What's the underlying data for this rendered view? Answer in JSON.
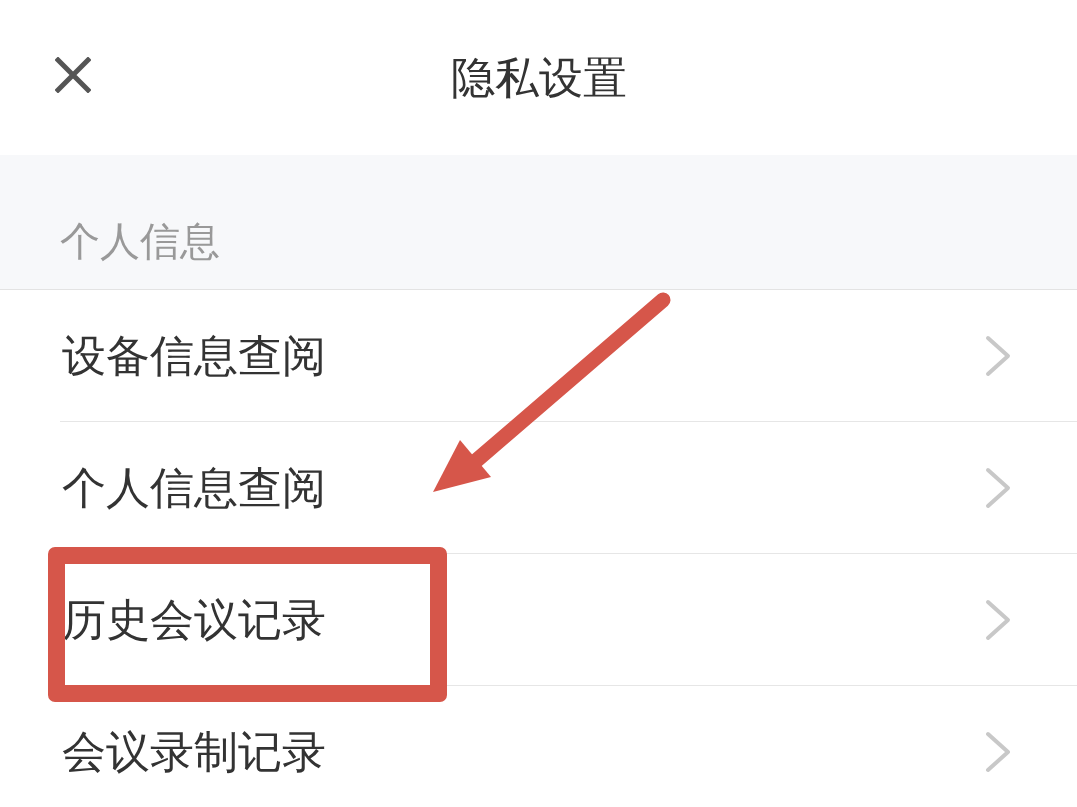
{
  "header": {
    "title": "隐私设置"
  },
  "section": {
    "title": "个人信息",
    "items": [
      {
        "label": "设备信息查阅",
        "highlighted": false
      },
      {
        "label": "个人信息查阅",
        "highlighted": false
      },
      {
        "label": "历史会议记录",
        "highlighted": true
      },
      {
        "label": "会议录制记录",
        "highlighted": false
      }
    ]
  },
  "annotation_arrow": true
}
